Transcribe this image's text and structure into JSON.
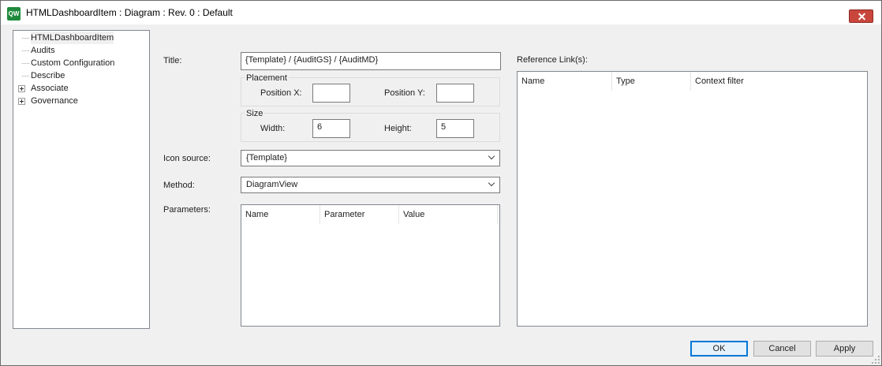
{
  "window": {
    "icon_text": "QW",
    "title": "HTMLDashboardItem : Diagram : Rev. 0 : Default"
  },
  "tree": {
    "items": [
      {
        "label": "HTMLDashboardItem",
        "expandable": false
      },
      {
        "label": "Audits",
        "expandable": false
      },
      {
        "label": "Custom Configuration",
        "expandable": false
      },
      {
        "label": "Describe",
        "expandable": false
      },
      {
        "label": "Associate",
        "expandable": true
      },
      {
        "label": "Governance",
        "expandable": true
      }
    ]
  },
  "form": {
    "title_label": "Title:",
    "title_value": "{Template} / {AuditGS} / {AuditMD}",
    "placement": {
      "group_label": "Placement",
      "x_label": "Position X:",
      "x_value": "",
      "y_label": "Position Y:",
      "y_value": ""
    },
    "size": {
      "group_label": "Size",
      "width_label": "Width:",
      "width_value": "6",
      "height_label": "Height:",
      "height_value": "5"
    },
    "icon_source_label": "Icon source:",
    "icon_source_value": "{Template}",
    "method_label": "Method:",
    "method_value": "DiagramView",
    "parameters_label": "Parameters:",
    "parameters_columns": [
      "Name",
      "Parameter",
      "Value"
    ]
  },
  "reference": {
    "label": "Reference Link(s):",
    "columns": [
      "Name",
      "Type",
      "Context filter"
    ]
  },
  "buttons": {
    "ok": "OK",
    "cancel": "Cancel",
    "apply": "Apply"
  }
}
